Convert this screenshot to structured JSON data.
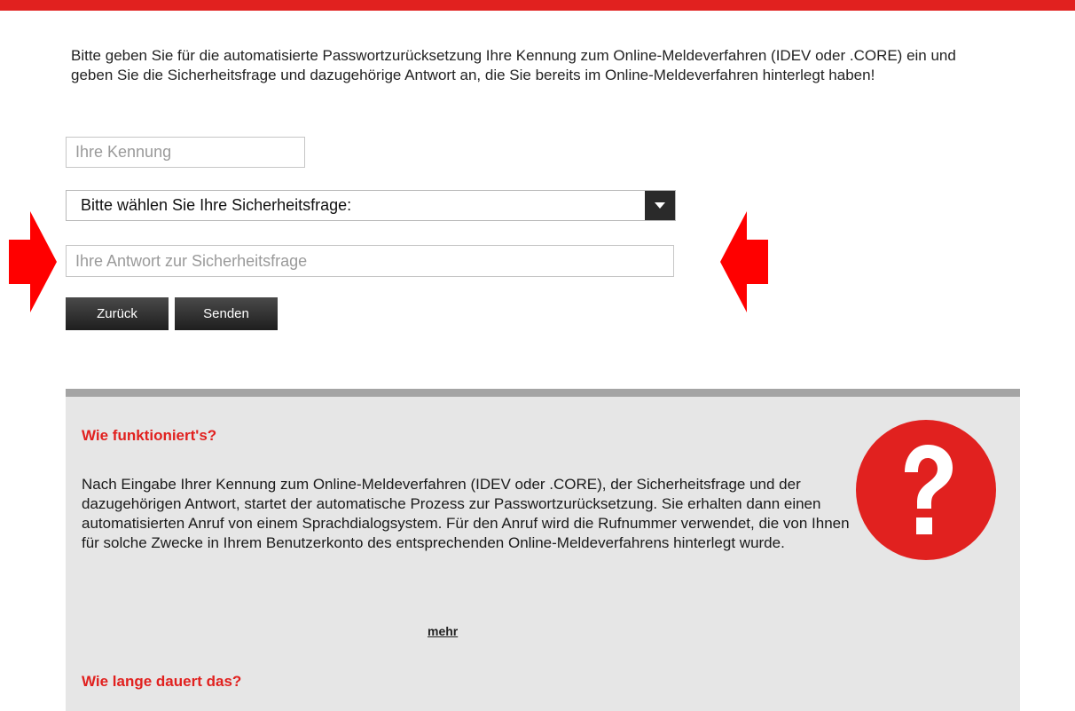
{
  "intro_text": "Bitte geben Sie für die automatisierte Passwortzurücksetzung Ihre Kennung zum Online-Meldeverfahren (IDEV oder .CORE) ein und geben Sie die Sicherheitsfrage und dazugehörige Antwort an, die Sie bereits im Online-Meldeverfahren hinterlegt haben!",
  "form": {
    "kennung_placeholder": "Ihre Kennung",
    "kennung_value": "",
    "security_question_selected": "Bitte wählen Sie Ihre Sicherheitsfrage:",
    "answer_placeholder": "Ihre Antwort zur Sicherheitsfrage",
    "answer_value": "",
    "back_label": "Zurück",
    "send_label": "Senden"
  },
  "info": {
    "how_title": "Wie funktioniert's?",
    "how_text": "Nach Eingabe Ihrer Kennung zum Online-Meldeverfahren (IDEV oder .CORE), der Sicherheitsfrage und der dazugehörigen Antwort, startet der automatische Prozess zur Passwortzurücksetzung. Sie erhalten dann einen automatisierten Anruf von einem Sprachdialogsystem. Für den Anruf wird die Rufnummer verwendet, die von Ihnen für solche Zwecke in Ihrem Benutzerkonto des entsprechenden Online-Meldeverfahrens hinterlegt wurde.",
    "more_label": "mehr",
    "duration_title": "Wie lange dauert das?",
    "icon": "question-mark-icon"
  },
  "colors": {
    "accent_red": "#e1211f",
    "panel_bg": "#e6e6e6",
    "panel_border": "#a4a4a4",
    "button_dark": "#2a2a2a"
  }
}
